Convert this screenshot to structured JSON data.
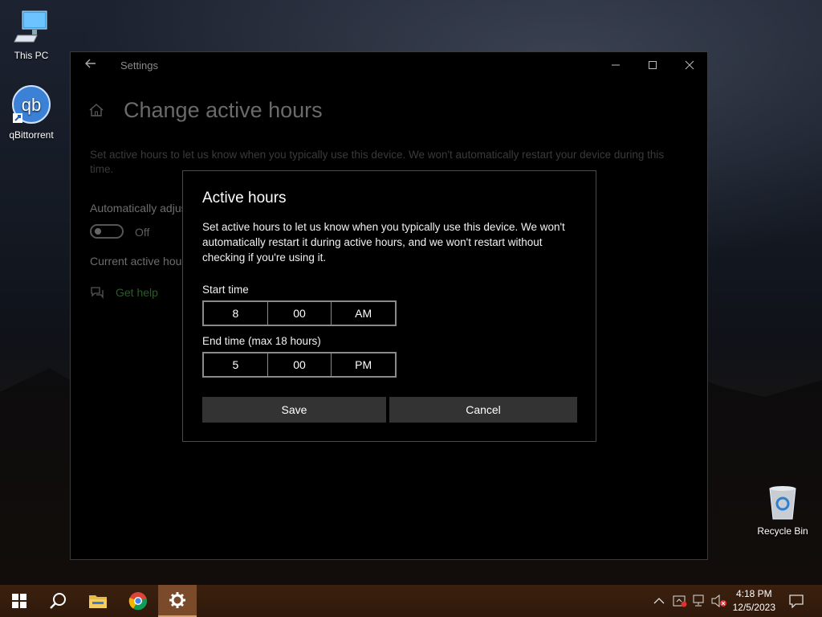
{
  "desktop": {
    "icons": [
      {
        "label": "This PC"
      },
      {
        "label": "qBittorrent"
      },
      {
        "label": "Recycle Bin"
      }
    ]
  },
  "window": {
    "title": "Settings",
    "page_title": "Change active hours",
    "description": "Set active hours to let us know when you typically use this device. We won't automatically restart your device during this time.",
    "auto_adjust_label": "Automatically adjust active hours",
    "toggle_state": "Off",
    "current_hours_label": "Current active hours",
    "get_help": "Get help"
  },
  "dialog": {
    "title": "Active hours",
    "description": "Set active hours to let us know when you typically use this device. We won't automatically restart it during active hours, and we won't restart without checking if you're using it.",
    "start_label": "Start time",
    "start": {
      "hour": "8",
      "minute": "00",
      "period": "AM"
    },
    "end_label": "End time (max 18 hours)",
    "end": {
      "hour": "5",
      "minute": "00",
      "period": "PM"
    },
    "save": "Save",
    "cancel": "Cancel"
  },
  "taskbar": {
    "time": "4:18 PM",
    "date": "12/5/2023"
  },
  "colors": {
    "taskbar": "#3a1f0d",
    "dialog_bg": "#000000",
    "button_bg": "#333333",
    "help_link": "#2e5a2a"
  }
}
